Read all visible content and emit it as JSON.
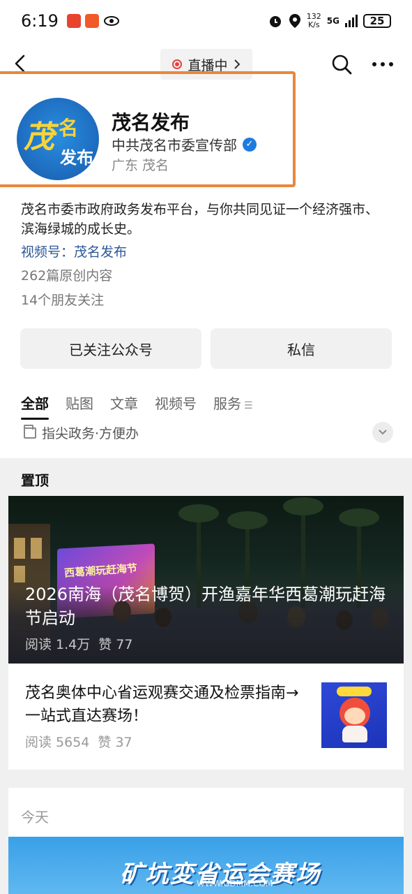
{
  "status_bar": {
    "time": "6:19",
    "net_speed_value": "132",
    "net_speed_unit": "K/s",
    "network": "5G",
    "battery": "25"
  },
  "nav": {
    "live_label": "直播中",
    "icons": [
      "back-icon",
      "live-dot-icon",
      "chevron-right-icon",
      "search-icon",
      "more-icon"
    ]
  },
  "account": {
    "name": "茂名发布",
    "org": "中共茂名市委宣传部",
    "location": "广东 茂名",
    "logo_text": [
      "茂",
      "名",
      "发布"
    ],
    "intro": "茂名市委市政府政务发布平台，与你共同见证一个经济强市、滨海绿城的成长史。",
    "video_channel_prefix": "视频号：",
    "video_channel_name": "茂名发布",
    "original_count": "262篇原创内容",
    "friends_following": "14个朋友关注"
  },
  "actions": {
    "follow_label": "已关注公众号",
    "message_label": "私信"
  },
  "tabs": [
    {
      "label": "全部",
      "active": true
    },
    {
      "label": "贴图",
      "active": false
    },
    {
      "label": "文章",
      "active": false
    },
    {
      "label": "视频号",
      "active": false
    },
    {
      "label": "服务",
      "active": false
    }
  ],
  "service_menu": {
    "label": "指尖政务·方便办"
  },
  "feed": {
    "pinned_label": "置顶",
    "pinned_items": [
      {
        "title": "2026南海（茂名博贺）开渔嘉年华西葛潮玩赶海节启动",
        "reads": "阅读 1.4万",
        "likes": "赞 77",
        "image_text": "西葛潮玩赶海节"
      },
      {
        "title": "茂名奥体中心省运观赛交通及检票指南→一站式直达赛场！",
        "reads": "阅读 5654",
        "likes": "赞 37"
      }
    ],
    "today_label": "今天",
    "today_banner_text": "矿坑変省运会赛场",
    "watermark": "WWW.GDMM.COM"
  },
  "colors": {
    "highlight": "#e8873c",
    "link": "#2b5797",
    "verified": "#1e7be0",
    "live": "#e64340",
    "feed_bg": "#f0f0f0"
  }
}
